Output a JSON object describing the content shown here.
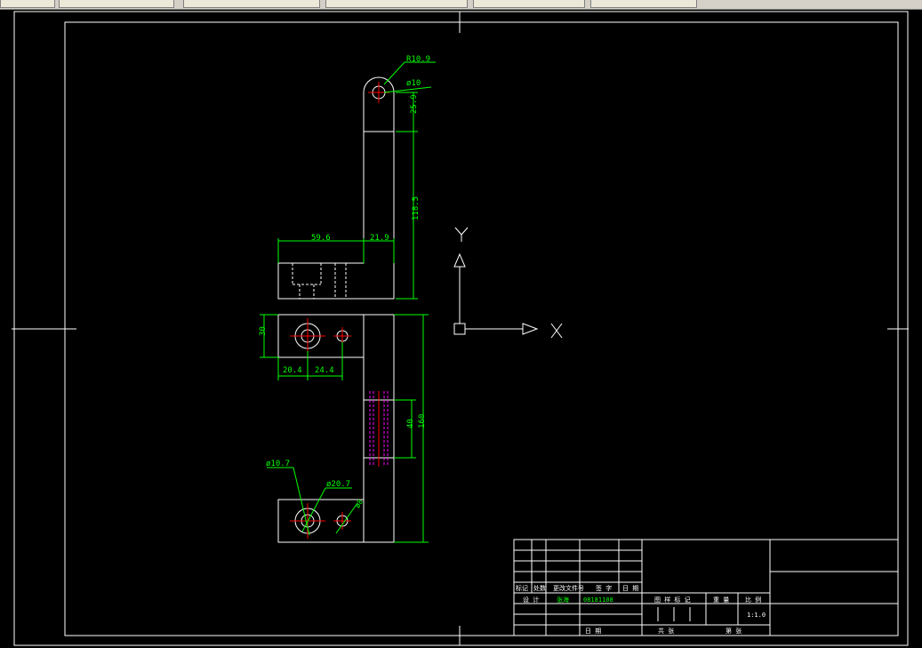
{
  "colors": {
    "background": "#000000",
    "frame": "#ffffff",
    "dimension": "#00ff00",
    "centerline": "#ff0000",
    "hidden": "#ff00ff",
    "tab_bg": "#ece9d8"
  },
  "taskbar": {
    "tabs": [
      "",
      "",
      "",
      "",
      "",
      ""
    ]
  },
  "ucs_icon": {
    "x_label": "X",
    "y_label": "Y"
  },
  "dimensions": {
    "r_top": "R10.9",
    "d_top": "ø10",
    "h_top": "25.9",
    "h_mid": "118.5",
    "w_left": "59.6",
    "w_right": "21.9",
    "plan_height": "30",
    "plan_w1": "20.4",
    "plan_w2": "24.4",
    "slot_len": "40",
    "total_len": "160",
    "hole_small": "ø10.7",
    "hole_big": "ø20.7",
    "hole_side": "ø8"
  },
  "title_block": {
    "rev_headers": [
      "标记",
      "处数",
      "更改文件号",
      "签 字",
      "日 期"
    ],
    "design_label": "设 计",
    "designer": "张海",
    "student_id": "08181108",
    "stage_label": "图 样 标 记",
    "weight_label": "重 量",
    "scale_label": "比 例",
    "scale_value": "1:1.0",
    "date_label": "日 期",
    "sheets_label": "共 张",
    "sheet_label": "第 张"
  }
}
